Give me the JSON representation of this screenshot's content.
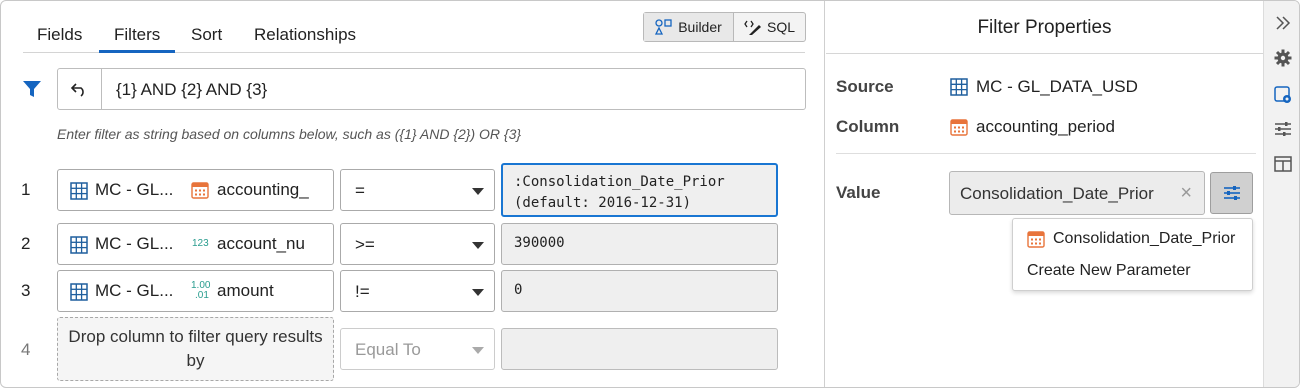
{
  "tabs": [
    "Fields",
    "Filters",
    "Sort",
    "Relationships"
  ],
  "active_tab": "Filters",
  "mode": {
    "builder_label": "Builder",
    "sql_label": "SQL"
  },
  "expression": {
    "value": "{1} AND {2} AND {3}"
  },
  "hint": "Enter filter as string based on columns below, such as ({1} AND {2}) OR {3}",
  "filters": [
    {
      "num": "1",
      "source": "MC - GL...",
      "column": "accounting_",
      "column_type": "date",
      "operator": "=",
      "value": ":Consolidation_Date_Prior\n(default: 2016-12-31)"
    },
    {
      "num": "2",
      "source": "MC - GL...",
      "column": "account_nu",
      "column_type": "integer",
      "type_glyph": "123",
      "operator": ">=",
      "value": "390000"
    },
    {
      "num": "3",
      "source": "MC - GL...",
      "column": "amount",
      "column_type": "decimal",
      "type_glyph_top": "1.00",
      "type_glyph_bottom": ".01",
      "operator": "!=",
      "value": "0"
    }
  ],
  "empty_row": {
    "num": "4",
    "drop_text": "Drop column to filter query results by",
    "operator": "Equal To"
  },
  "properties": {
    "title": "Filter Properties",
    "source_label": "Source",
    "source_value": "MC - GL_DATA_USD",
    "column_label": "Column",
    "column_value": "accounting_period",
    "value_label": "Value",
    "value_param": "Consolidation_Date_Prior",
    "clear_glyph": "×"
  },
  "param_menu": {
    "items": [
      "Consolidation_Date_Prior",
      "Create New Parameter"
    ]
  },
  "colors": {
    "accent": "#1565c0",
    "date_icon": "#e8743b",
    "table_icon": "#1f5f9e",
    "numeric_icon": "#2a9d8f"
  }
}
